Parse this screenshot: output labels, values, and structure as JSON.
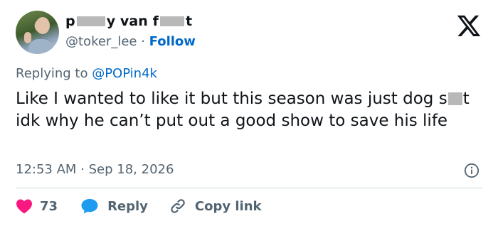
{
  "author": {
    "name_start": "p",
    "name_middle": "y van f",
    "name_end": "t",
    "handle": "@toker_lee",
    "separator": " · ",
    "follow_label": "Follow"
  },
  "reply_context": {
    "prefix": "Replying to ",
    "mention": "@POPin4k"
  },
  "tweet": {
    "text_part1": "Like I wanted to like it but this season was just dog s",
    "text_part2": "t idk why he can’t put out a good show to save his life"
  },
  "meta": {
    "time": "12:53 AM",
    "separator": " · ",
    "date": "Sep 18, 2026"
  },
  "actions": {
    "likes_count": "73",
    "reply_label": "Reply",
    "copy_link_label": "Copy link"
  },
  "colors": {
    "link_blue": "#0068c8",
    "like_red": "#f91880",
    "reply_blue": "#1d9bf0",
    "muted_gray": "#536471"
  },
  "icons": {
    "brand": "x-logo-icon",
    "info": "info-icon",
    "like": "heart-icon",
    "reply": "speech-bubble-icon",
    "copy": "link-icon"
  }
}
